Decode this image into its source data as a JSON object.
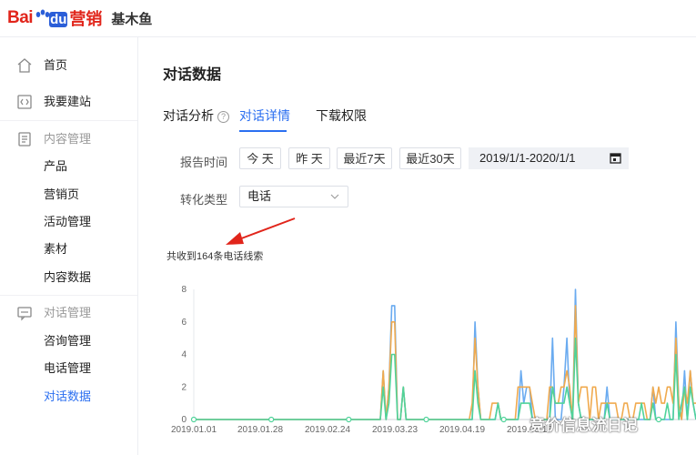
{
  "brand": {
    "logo_bai": "Bai",
    "logo_du": "du",
    "logo_yingxiao": "营销",
    "product": "基木鱼"
  },
  "sidebar": {
    "items": [
      {
        "label": "首页",
        "icon": "home-icon",
        "kind": "top"
      },
      {
        "label": "我要建站",
        "icon": "code-icon",
        "kind": "top"
      },
      {
        "label": "内容管理",
        "icon": "document-icon",
        "kind": "group"
      },
      {
        "label": "产品",
        "kind": "sub"
      },
      {
        "label": "营销页",
        "kind": "sub"
      },
      {
        "label": "活动管理",
        "kind": "sub"
      },
      {
        "label": "素材",
        "kind": "sub"
      },
      {
        "label": "内容数据",
        "kind": "sub"
      },
      {
        "label": "对话管理",
        "icon": "chat-icon",
        "kind": "group"
      },
      {
        "label": "咨询管理",
        "kind": "sub"
      },
      {
        "label": "电话管理",
        "kind": "sub"
      },
      {
        "label": "对话数据",
        "kind": "sub",
        "active": true
      }
    ]
  },
  "main": {
    "title": "对话数据",
    "tabs": [
      {
        "label": "对话分析",
        "help": "?"
      },
      {
        "label": "对话详情",
        "active": true
      },
      {
        "label": "下载权限"
      }
    ],
    "filters": {
      "report_time_label": "报告时间",
      "today": "今 天",
      "yesterday": "昨 天",
      "last7": "最近7天",
      "last30": "最近30天",
      "date_range": "2019/1/1-2020/1/1",
      "conversion_type_label": "转化类型",
      "conversion_type_value": "电话"
    },
    "summary": "共收到164条电话线索"
  },
  "colors": {
    "accent": "#2b6ff0",
    "series_blue": "#6aabf0",
    "series_orange": "#f0aa4e",
    "series_green": "#4fd39a"
  },
  "watermark": "竞价信息流日记",
  "chart_data": {
    "type": "line",
    "ylim": [
      0,
      8
    ],
    "yticks": [
      0,
      2,
      4,
      6,
      8
    ],
    "xticks": [
      "2019.01.01",
      "2019.01.28",
      "2019.02.24",
      "2019.03.23",
      "2019.04.19",
      "2019.05.16"
    ],
    "x_start": "2019-01-01",
    "series": [
      {
        "color": "#6aabf0",
        "values": [
          0,
          0,
          0,
          0,
          0,
          0,
          0,
          0,
          0,
          0,
          0,
          0,
          0,
          0,
          0,
          0,
          0,
          0,
          0,
          0,
          0,
          0,
          0,
          0,
          0,
          0,
          0,
          0,
          0,
          0,
          0,
          0,
          0,
          0,
          0,
          0,
          0,
          0,
          0,
          0,
          0,
          0,
          0,
          0,
          0,
          0,
          0,
          0,
          0,
          0,
          0,
          0,
          0,
          0,
          0,
          0,
          0,
          0,
          0,
          0,
          0,
          0,
          0,
          0,
          0,
          0,
          3,
          0,
          2,
          7,
          7,
          0,
          0,
          2,
          0,
          0,
          0,
          0,
          0,
          0,
          0,
          0,
          0,
          0,
          0,
          0,
          0,
          0,
          0,
          0,
          0,
          0,
          0,
          0,
          0,
          0,
          0,
          0,
          6,
          2,
          0,
          0,
          0,
          0,
          0,
          0,
          1,
          0,
          0,
          0,
          0,
          0,
          0,
          0,
          3,
          1,
          2,
          2,
          0,
          0,
          0,
          0,
          0,
          0,
          0,
          5,
          0,
          0,
          0,
          2,
          5,
          1,
          0,
          8,
          1,
          0,
          0,
          0,
          0,
          0,
          0,
          0,
          0,
          0,
          2,
          0,
          0,
          0,
          0,
          0,
          0,
          0,
          0,
          0,
          0,
          0,
          0,
          0,
          0,
          0,
          2,
          0,
          0,
          0,
          0,
          0,
          0,
          0,
          6,
          1,
          0,
          3,
          0,
          3,
          1,
          0
        ]
      },
      {
        "color": "#f0aa4e",
        "values": [
          0,
          0,
          0,
          0,
          0,
          0,
          0,
          0,
          0,
          0,
          0,
          0,
          0,
          0,
          0,
          0,
          0,
          0,
          0,
          0,
          0,
          0,
          0,
          0,
          0,
          0,
          0,
          0,
          0,
          0,
          0,
          0,
          0,
          0,
          0,
          0,
          0,
          0,
          0,
          0,
          0,
          0,
          0,
          0,
          0,
          0,
          0,
          0,
          0,
          0,
          0,
          0,
          0,
          0,
          0,
          0,
          0,
          0,
          0,
          0,
          0,
          0,
          0,
          0,
          0,
          0,
          3,
          0,
          2,
          6,
          6,
          0,
          0,
          2,
          0,
          0,
          0,
          0,
          0,
          0,
          0,
          0,
          0,
          0,
          0,
          0,
          0,
          0,
          0,
          0,
          0,
          0,
          0,
          0,
          0,
          0,
          0,
          1,
          5,
          2,
          0,
          0,
          0,
          0,
          1,
          1,
          1,
          0,
          0,
          0,
          0,
          0,
          0,
          2,
          2,
          2,
          2,
          2,
          1,
          0,
          0,
          0,
          0,
          0,
          2,
          2,
          1,
          1,
          2,
          2,
          3,
          2,
          0,
          7,
          1,
          2,
          2,
          2,
          0,
          2,
          2,
          0,
          1,
          1,
          1,
          1,
          1,
          1,
          0,
          0,
          1,
          1,
          0,
          0,
          1,
          1,
          1,
          1,
          0,
          0,
          2,
          1,
          2,
          1,
          1,
          2,
          2,
          1,
          5,
          1,
          0,
          2,
          1,
          3,
          1,
          1
        ]
      },
      {
        "color": "#4fd39a",
        "values": [
          0,
          0,
          0,
          0,
          0,
          0,
          0,
          0,
          0,
          0,
          0,
          0,
          0,
          0,
          0,
          0,
          0,
          0,
          0,
          0,
          0,
          0,
          0,
          0,
          0,
          0,
          0,
          0,
          0,
          0,
          0,
          0,
          0,
          0,
          0,
          0,
          0,
          0,
          0,
          0,
          0,
          0,
          0,
          0,
          0,
          0,
          0,
          0,
          0,
          0,
          0,
          0,
          0,
          0,
          0,
          0,
          0,
          0,
          0,
          0,
          0,
          0,
          0,
          0,
          0,
          0,
          2,
          0,
          1,
          4,
          4,
          0,
          0,
          2,
          0,
          0,
          0,
          0,
          0,
          0,
          0,
          0,
          0,
          0,
          0,
          0,
          0,
          0,
          0,
          0,
          0,
          0,
          0,
          0,
          0,
          0,
          0,
          0,
          3,
          1,
          0,
          0,
          0,
          0,
          0,
          0,
          1,
          0,
          0,
          0,
          0,
          0,
          0,
          0,
          1,
          1,
          1,
          1,
          0,
          0,
          0,
          0,
          0,
          0,
          0,
          2,
          1,
          1,
          1,
          1,
          2,
          1,
          0,
          5,
          1,
          0,
          0,
          0,
          0,
          0,
          0,
          0,
          0,
          0,
          1,
          0,
          0,
          0,
          0,
          0,
          0,
          0,
          0,
          0,
          0,
          0,
          1,
          0,
          0,
          0,
          1,
          0,
          0,
          0,
          0,
          1,
          0,
          0,
          4,
          0,
          1,
          2,
          0,
          2,
          1,
          0
        ]
      }
    ]
  }
}
